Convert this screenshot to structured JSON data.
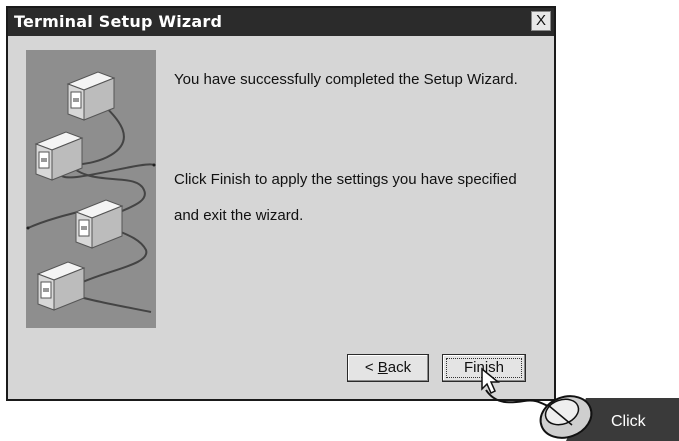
{
  "window": {
    "title": "Terminal Setup Wizard",
    "close_label": "X"
  },
  "content": {
    "line1": "You have successfully completed the Setup Wizard.",
    "line2": "Click Finish to apply the settings you have specified",
    "line3": "and exit the wizard."
  },
  "buttons": {
    "back_prefix": "< ",
    "back_mnemonic": "B",
    "back_rest": "ack",
    "finish_label": "Finish"
  },
  "callout": {
    "label": "Click"
  },
  "icons": {
    "side_image": "networked-computers-illustration",
    "mouse": "mouse-icon",
    "cursor": "arrow-cursor-icon"
  }
}
